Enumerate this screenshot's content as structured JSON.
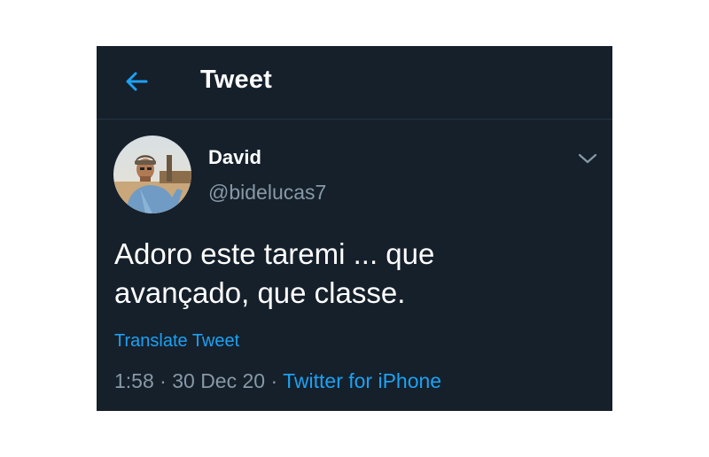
{
  "header": {
    "back_icon": "arrow-left-icon",
    "title": "Tweet"
  },
  "tweet": {
    "author": {
      "display_name": "David",
      "handle": "@bidelucas7"
    },
    "menu_icon": "chevron-down-icon",
    "text_line1": "Adoro este taremi ... que",
    "text_line2": "avançado, que classe.",
    "translate_label": "Translate Tweet",
    "time": "1:58",
    "separator": "·",
    "date": "30 Dec 20",
    "source": "Twitter for iPhone"
  },
  "colors": {
    "background": "#15202b",
    "accent": "#1da1f2",
    "secondary_text": "#8899a6",
    "divider": "#253341"
  }
}
